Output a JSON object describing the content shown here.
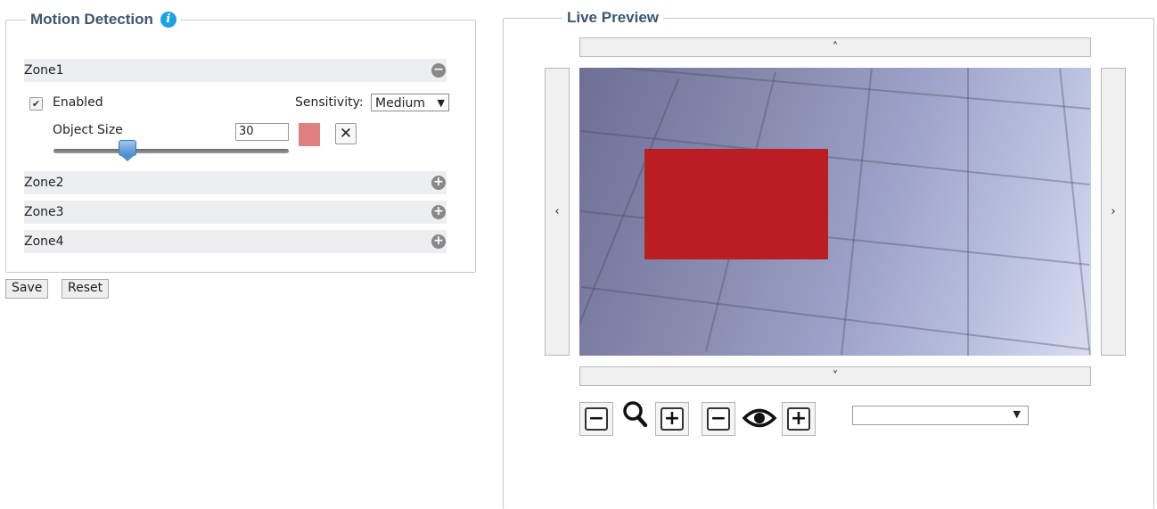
{
  "motion_detection": {
    "title": "Motion Detection",
    "info_icon": "i",
    "zones": [
      {
        "label": "Zone1",
        "toggle": "−",
        "expanded": true
      },
      {
        "label": "Zone2",
        "toggle": "+",
        "expanded": false
      },
      {
        "label": "Zone3",
        "toggle": "+",
        "expanded": false
      },
      {
        "label": "Zone4",
        "toggle": "+",
        "expanded": false
      }
    ],
    "zone1": {
      "enabled_label": "Enabled",
      "enabled_checked": true,
      "checkmark": "✔",
      "sensitivity_label": "Sensitivity:",
      "sensitivity_value": "Medium",
      "object_size_label": "Object Size",
      "object_size_value": "30",
      "slider_fraction": 0.31,
      "zone_color": "#e07f7f",
      "delete_symbol": "✕"
    },
    "save_label": "Save",
    "reset_label": "Reset"
  },
  "live_preview": {
    "title": "Live Preview",
    "pan_up": "˄",
    "pan_down": "˅",
    "pan_left": "‹",
    "pan_right": "›",
    "overlay_color": "#bb1e22",
    "controls": {
      "zoom_out": "−",
      "zoom_in": "+",
      "zoom_icon": "magnifier-icon",
      "focus_out": "−",
      "focus_in": "+",
      "focus_icon": "eye-icon"
    },
    "preset_dropdown_value": "",
    "dropdown_arrow": "▼"
  }
}
